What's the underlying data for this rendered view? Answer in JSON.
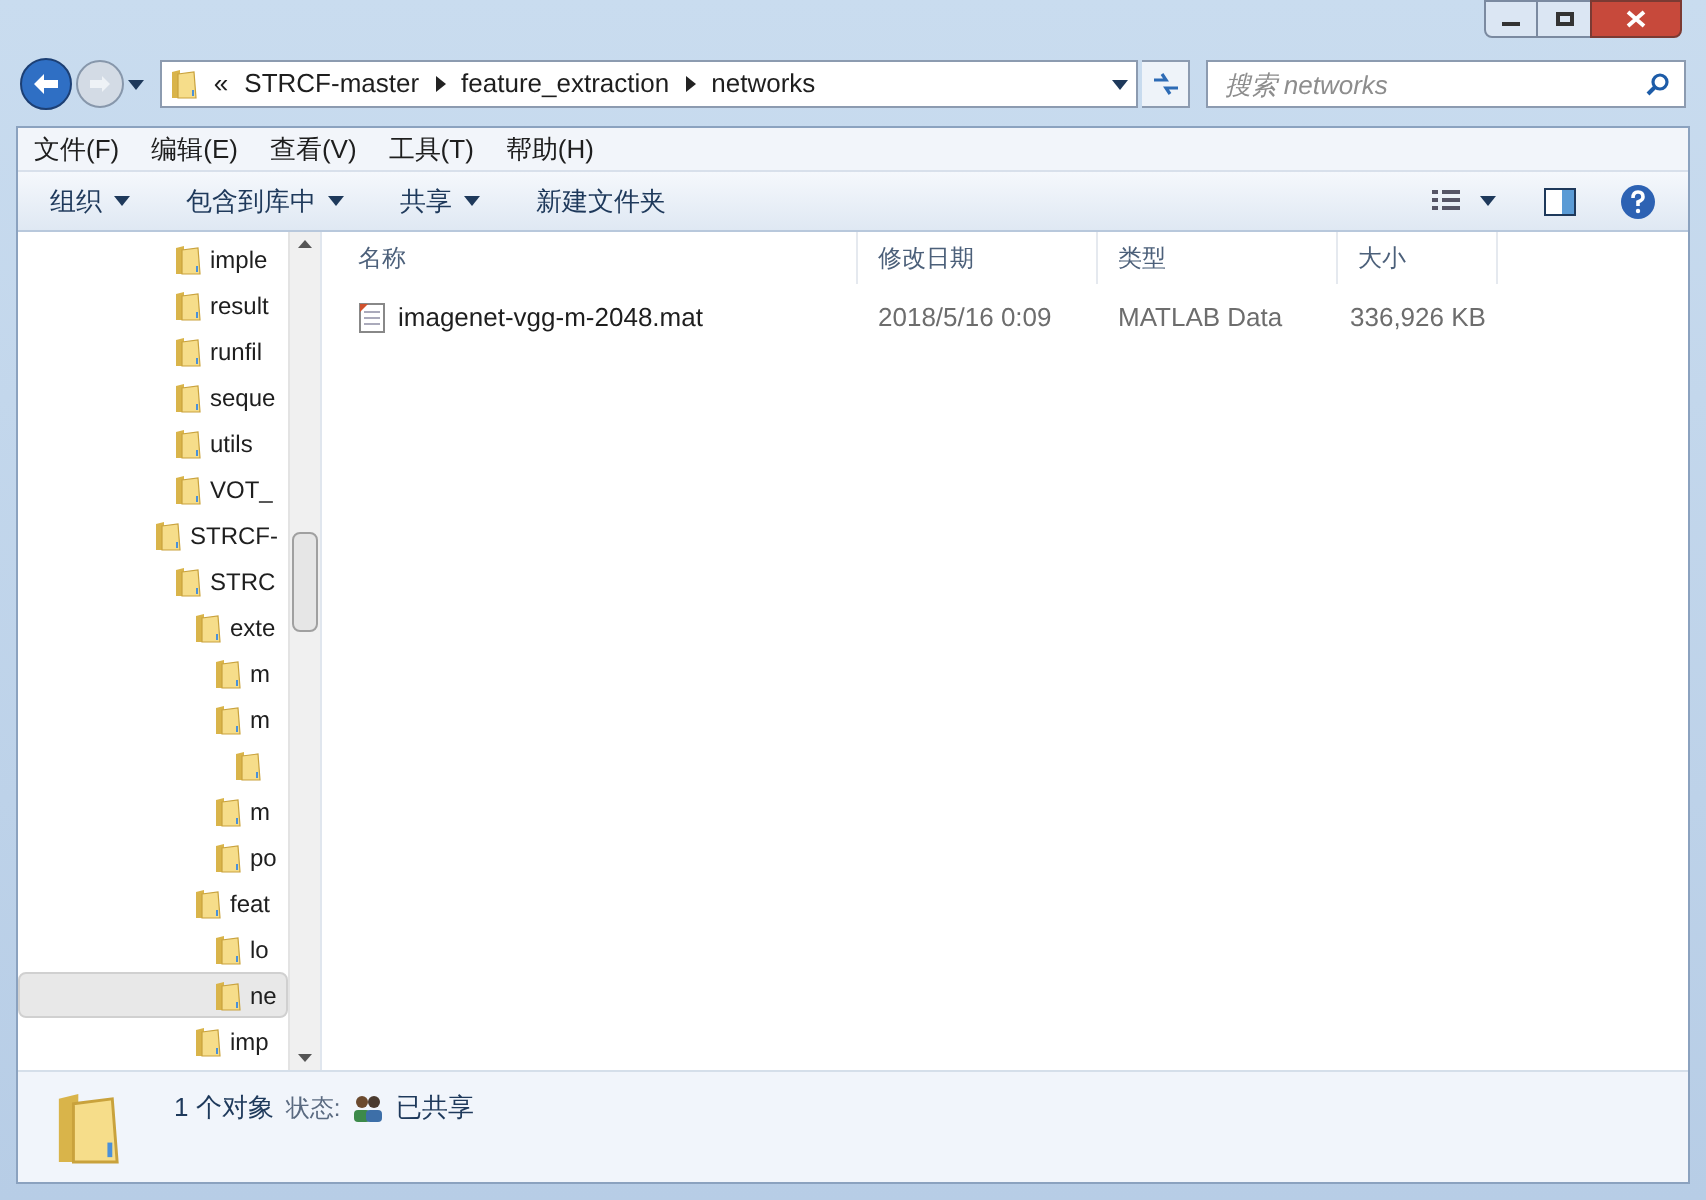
{
  "address_bar": {
    "overflow": "«",
    "path": [
      "STRCF-master",
      "feature_extraction",
      "networks"
    ]
  },
  "search": {
    "placeholder": "搜索 networks"
  },
  "menu": [
    "文件(F)",
    "编辑(E)",
    "查看(V)",
    "工具(T)",
    "帮助(H)"
  ],
  "toolbar": [
    {
      "label": "组织",
      "dropdown": true
    },
    {
      "label": "包含到库中",
      "dropdown": true
    },
    {
      "label": "共享",
      "dropdown": true
    },
    {
      "label": "新建文件夹",
      "dropdown": false
    }
  ],
  "tree": [
    {
      "children": [
        {
          "name": "imple",
          "selected": false
        },
        {
          "name": "result",
          "selected": false
        },
        {
          "name": "runfil",
          "selected": false
        },
        {
          "name": "seque",
          "selected": false
        },
        {
          "name": "utils",
          "selected": false
        },
        {
          "name": "VOT_",
          "selected": false
        }
      ]
    },
    {
      "name": "STRCF-",
      "selected": false,
      "children": [
        {
          "name": "STRC",
          "selected": false,
          "children": [
            {
              "name": "exte",
              "selected": false,
              "children": [
                {
                  "name": "m",
                  "selected": false
                },
                {
                  "name": "m",
                  "selected": false,
                  "children": [
                    {
                      "selected": false
                    }
                  ]
                },
                {
                  "name": "m",
                  "selected": false
                },
                {
                  "name": "po",
                  "selected": false
                }
              ]
            },
            {
              "name": "feat",
              "selected": false,
              "children": [
                {
                  "name": "lo",
                  "selected": false
                },
                {
                  "name": "ne",
                  "selected": true
                }
              ]
            },
            {
              "name": "imp",
              "selected": false
            }
          ]
        }
      ]
    }
  ],
  "columns": [
    "名称",
    "修改日期",
    "类型",
    "大小"
  ],
  "files": [
    {
      "name": "imagenet-vgg-m-2048.mat",
      "modified": "2018/5/16 0:09",
      "type": "MATLAB Data",
      "size": "336,926 KB"
    }
  ],
  "status_bar": {
    "count": "1 个对象",
    "state_label": "状态:",
    "state": "已共享"
  }
}
